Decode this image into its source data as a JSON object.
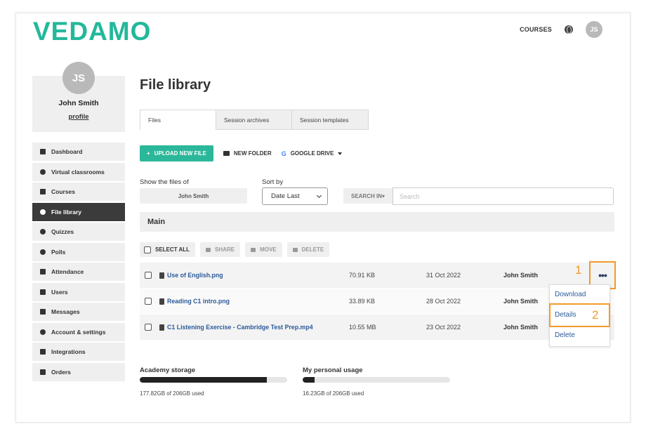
{
  "brand": {
    "logo": "VEDAMO",
    "color": "#23b89a"
  },
  "topnav": {
    "courses": "COURSES",
    "globe_icon": "globe-icon",
    "user_initials": "JS"
  },
  "profile": {
    "initials": "JS",
    "name": "John Smith",
    "link": "profile"
  },
  "sidebar": {
    "items": [
      {
        "label": "Dashboard",
        "icon": "grid-icon"
      },
      {
        "label": "Virtual classrooms",
        "icon": "play-circle-icon"
      },
      {
        "label": "Courses",
        "icon": "book-icon"
      },
      {
        "label": "File library",
        "icon": "cloud-upload-icon",
        "active": true
      },
      {
        "label": "Quizzes",
        "icon": "question-icon"
      },
      {
        "label": "Polls",
        "icon": "question-icon"
      },
      {
        "label": "Attendance",
        "icon": "document-icon"
      },
      {
        "label": "Users",
        "icon": "users-icon"
      },
      {
        "label": "Messages",
        "icon": "envelope-icon"
      },
      {
        "label": "Account & settings",
        "icon": "gear-icon"
      },
      {
        "label": "Integrations",
        "icon": "plug-icon"
      },
      {
        "label": "Orders",
        "icon": "cart-icon"
      }
    ]
  },
  "page": {
    "title": "File library"
  },
  "tabs": [
    {
      "label": "Files"
    },
    {
      "label": "Session archives"
    },
    {
      "label": "Session templates"
    }
  ],
  "actions": {
    "upload": "UPLOAD NEW FILE",
    "new_folder": "NEW FOLDER",
    "google_drive": "GOOGLE DRIVE"
  },
  "filters": {
    "show_label": "Show the files of",
    "owner_value": "John Smith",
    "sort_label": "Sort by",
    "sort_value": "Date Last",
    "search_in": "SEARCH IN▾",
    "search_placeholder": "Search"
  },
  "folder": {
    "name": "Main"
  },
  "bulk": {
    "select_all": "SELECT ALL",
    "share": "SHARE",
    "move": "MOVE",
    "delete": "DELETE"
  },
  "files": [
    {
      "name": "Use of English.png",
      "size": "70.91 KB",
      "date": "31 Oct 2022",
      "owner": "John Smith"
    },
    {
      "name": "Reading C1 intro.png",
      "size": "33.89 KB",
      "date": "28 Oct 2022",
      "owner": "John Smith"
    },
    {
      "name": "C1 Listening Exercise - Cambridge Test Prep.mp4",
      "size": "10.55 MB",
      "date": "23 Oct 2022",
      "owner": "John Smith"
    }
  ],
  "annotations": {
    "step1": "1",
    "step2": "2",
    "highlight_color": "#f29a28"
  },
  "more_button": "•••",
  "context_menu": {
    "download": "Download",
    "details": "Details",
    "delete": "Delete"
  },
  "storage": {
    "academy": {
      "label": "Academy storage",
      "used": "177.82GB of 206GB used",
      "fraction": 0.863
    },
    "personal": {
      "label": "My personal usage",
      "used": "16.23GB of 206GB used",
      "fraction": 0.079
    }
  }
}
